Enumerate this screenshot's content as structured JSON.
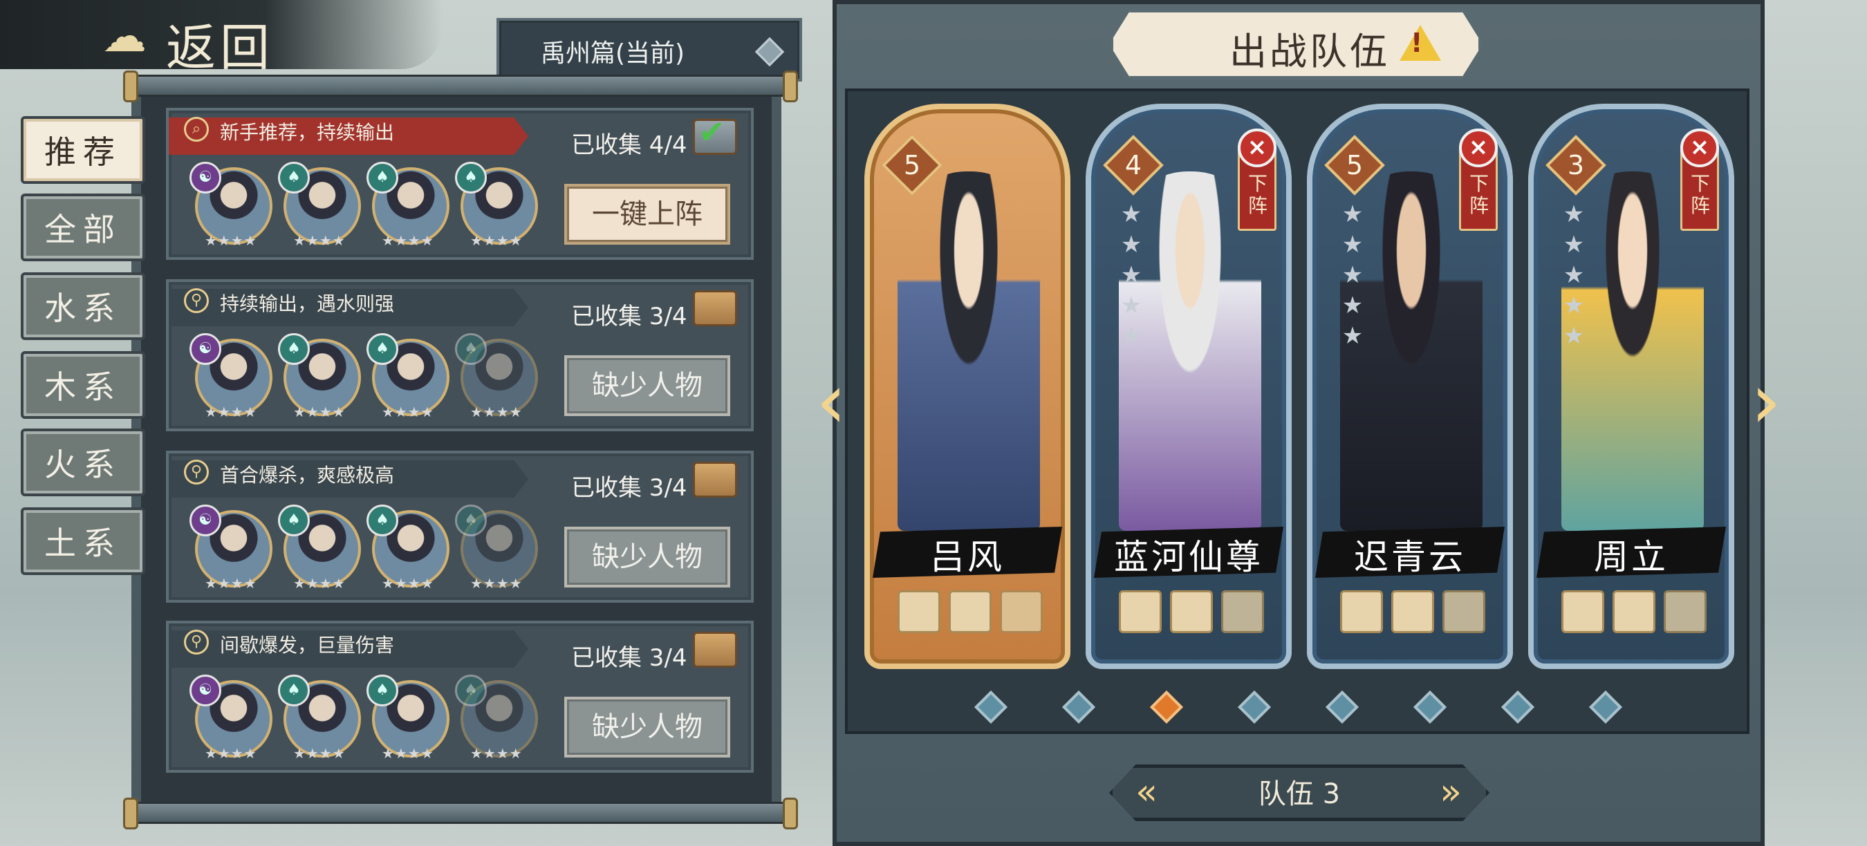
{
  "header": {
    "back_label": "返回",
    "back_icon": "cloud-swirl-icon"
  },
  "chapter": {
    "label": "禹州篇(当前)",
    "icon": "diamond-icon"
  },
  "tabs": [
    {
      "label": "推荐",
      "active": true
    },
    {
      "label": "全部"
    },
    {
      "label": "水系"
    },
    {
      "label": "木系"
    },
    {
      "label": "火系"
    },
    {
      "label": "土系"
    }
  ],
  "teams": [
    {
      "desc": "新手推荐，持续输出",
      "collected": "已收集 4/4",
      "button": "一键上阵",
      "complete": true,
      "banner_icon": "magnifier-icon",
      "members": [
        {
          "elem": "yinyang",
          "stars": 4
        },
        {
          "elem": "wood",
          "stars": 4
        },
        {
          "elem": "wood",
          "stars": 4
        },
        {
          "elem": "wood",
          "stars": 4
        }
      ]
    },
    {
      "desc": "持续输出，遇水则强",
      "collected": "已收集 3/4",
      "button": "缺少人物",
      "complete": false,
      "banner_icon": "lock-icon",
      "members": [
        {
          "elem": "yinyang",
          "stars": 4
        },
        {
          "elem": "wood",
          "stars": 4
        },
        {
          "elem": "wood",
          "stars": 4
        },
        {
          "elem": "wood",
          "stars": 4,
          "dim": true
        }
      ]
    },
    {
      "desc": "首合爆杀，爽感极高",
      "collected": "已收集 3/4",
      "button": "缺少人物",
      "complete": false,
      "banner_icon": "lock-icon",
      "members": [
        {
          "elem": "yinyang",
          "stars": 4
        },
        {
          "elem": "wood",
          "stars": 4
        },
        {
          "elem": "wood",
          "stars": 4
        },
        {
          "elem": "wood",
          "stars": 4,
          "dim": true
        }
      ]
    },
    {
      "desc": "间歇爆发，巨量伤害",
      "collected": "已收集 3/4",
      "button": "缺少人物",
      "complete": false,
      "banner_icon": "lock-icon",
      "members": [
        {
          "elem": "yinyang",
          "stars": 4
        },
        {
          "elem": "wood",
          "stars": 4
        },
        {
          "elem": "wood",
          "stars": 4
        },
        {
          "elem": "wood",
          "stars": 4,
          "dim": true
        }
      ]
    }
  ],
  "battle": {
    "title": "出战队伍",
    "warning_icon": "warning-icon",
    "unequip_label": "下阵",
    "heroes": [
      {
        "name": "吕风",
        "level": "5",
        "stars": 0,
        "style": "gold"
      },
      {
        "name": "蓝河仙尊",
        "level": "4",
        "stars": 5,
        "style": "elder"
      },
      {
        "name": "迟青云",
        "level": "5",
        "stars": 5,
        "style": "dark"
      },
      {
        "name": "周立",
        "level": "3",
        "stars": 5,
        "style": "yellow"
      }
    ],
    "page_dots": 8,
    "active_dot": 2,
    "team_label": "队伍 3"
  },
  "colors": {
    "accent": "#e07a2a",
    "danger": "#c2322b",
    "gold": "#e8c383"
  }
}
